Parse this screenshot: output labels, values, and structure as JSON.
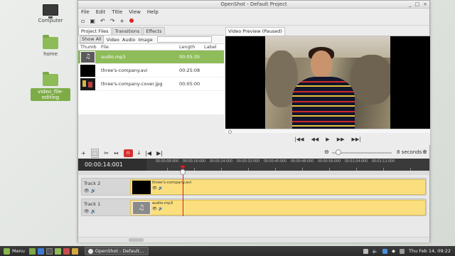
{
  "desktop": {
    "icons": [
      {
        "label": "Computer"
      },
      {
        "label": "home"
      },
      {
        "label": "video_file-editing"
      }
    ]
  },
  "window": {
    "title": "OpenShot - Default Project",
    "menu": [
      "File",
      "Edit",
      "Title",
      "View",
      "Help"
    ]
  },
  "files_panel": {
    "tabs": [
      "Project Files",
      "Transitions",
      "Effects"
    ],
    "filters": [
      "Show All",
      "Video",
      "Audio",
      "Image"
    ],
    "filter_placeholder": "",
    "columns": [
      "Thumb",
      "File",
      "Length",
      "Label"
    ],
    "rows": [
      {
        "file": "audio.mp3",
        "length": "00:05:35",
        "label": "",
        "thumb": "audio-icon"
      },
      {
        "file": "three's-company.avi",
        "length": "00:25:08",
        "label": "",
        "thumb": "video-thumb"
      },
      {
        "file": "three's-company-cover.jpg",
        "length": "00:05:00",
        "label": "",
        "thumb": "image-thumb"
      }
    ]
  },
  "preview": {
    "tab": "Video Preview (Paused)"
  },
  "timeline": {
    "timecode": "00:00:14:001",
    "zoom_label": "8 seconds",
    "ruler_ticks": [
      "00:00:08:000",
      "00:00:16:000",
      "00:00:24:000",
      "00:00:32:000",
      "00:00:40:000",
      "00:00:48:000",
      "00:00:56:000",
      "00:01:04:000",
      "00:01:12:000"
    ],
    "tracks": [
      {
        "name": "Track 2",
        "clip": "three's-company.avi"
      },
      {
        "name": "Track 1",
        "clip": "audio.mp3"
      }
    ]
  },
  "taskbar": {
    "menu": "Menu",
    "task": "OpenShot - Default...",
    "clock": "Thu Feb 14, 09:22"
  },
  "colors": {
    "selection": "#8fbc5a",
    "clip": "#fbdf7e",
    "playhead": "#d21f1f"
  }
}
